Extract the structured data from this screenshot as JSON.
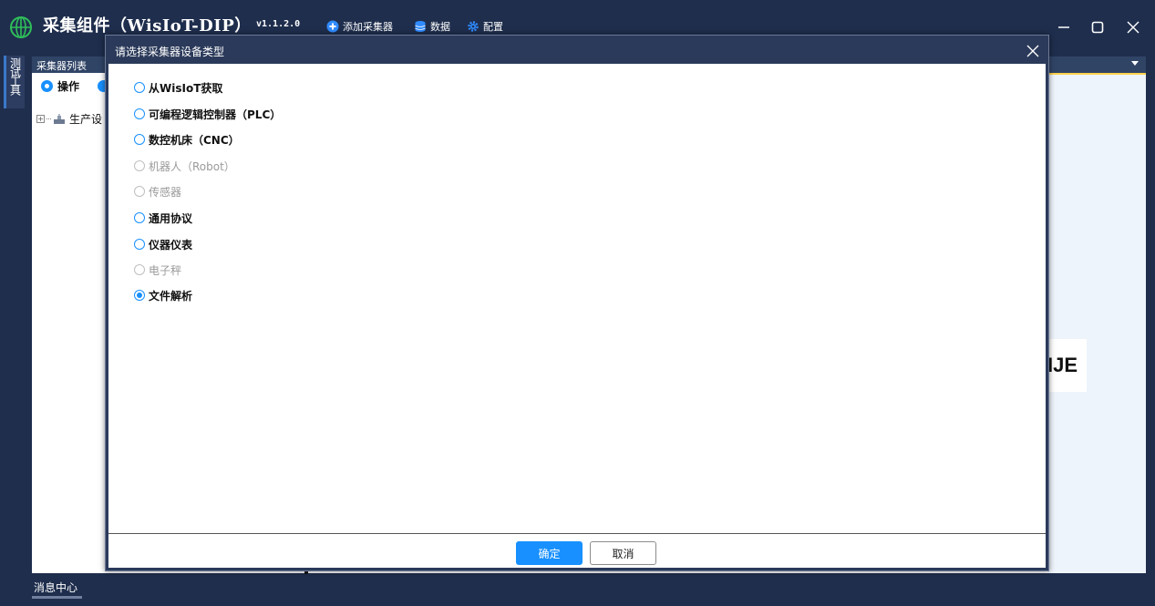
{
  "app": {
    "title": "采集组件（WisIoT-DIP）",
    "version": "v1.1.2.0",
    "menu": [
      {
        "label": "添加采集器",
        "icon": "plus-circle-icon"
      },
      {
        "label": "数据",
        "icon": "database-icon"
      },
      {
        "label": "配置",
        "icon": "gear-icon"
      }
    ]
  },
  "side_tab": {
    "label": "测试工具"
  },
  "collector_panel": {
    "header": "采集器列表",
    "toolbar_label": "操作",
    "tree_item": "生产设"
  },
  "brand_text": "INJE",
  "message_center": "消息中心",
  "dialog": {
    "title": "请选择采集器设备类型",
    "options": [
      {
        "label": "从WisIoT获取",
        "state": "enabled"
      },
      {
        "label": "可编程逻辑控制器（PLC）",
        "state": "enabled"
      },
      {
        "label": "数控机床（CNC）",
        "state": "enabled"
      },
      {
        "label": "机器人（Robot）",
        "state": "disabled"
      },
      {
        "label": "传感器",
        "state": "disabled"
      },
      {
        "label": "通用协议",
        "state": "enabled"
      },
      {
        "label": "仪器仪表",
        "state": "enabled"
      },
      {
        "label": "电子秤",
        "state": "disabled"
      },
      {
        "label": "文件解析",
        "state": "selected"
      }
    ],
    "ok_label": "确定",
    "cancel_label": "取消"
  },
  "colors": {
    "titlebar_bg": "#1f2e4d",
    "accent": "#1890ff",
    "panel_header": "#304466",
    "logo": "#2fbf5a"
  }
}
